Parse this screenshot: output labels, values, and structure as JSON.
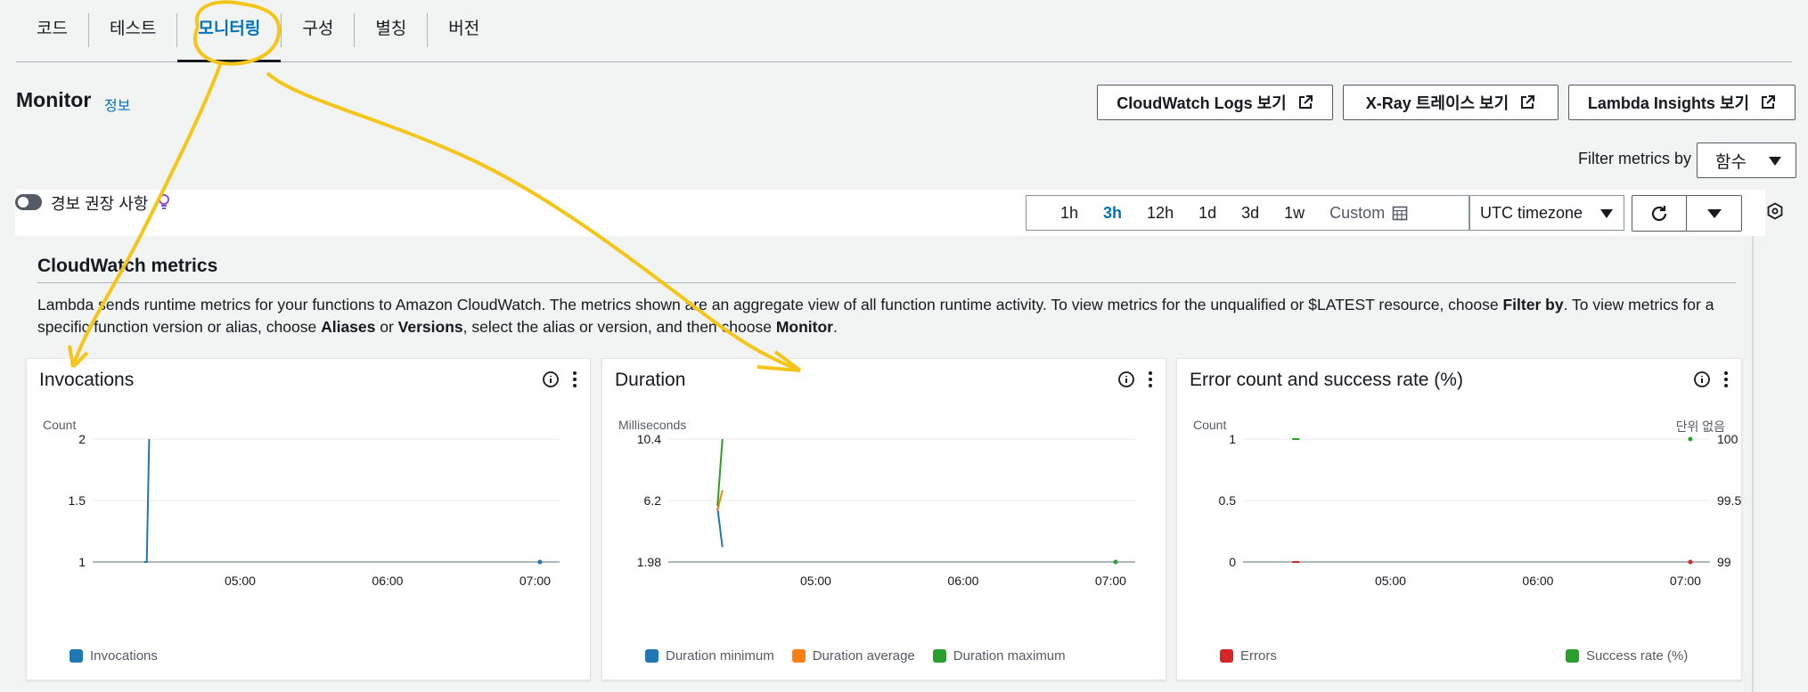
{
  "tabs": [
    {
      "label": "코드",
      "active": false
    },
    {
      "label": "테스트",
      "active": false
    },
    {
      "label": "모니터링",
      "active": true
    },
    {
      "label": "구성",
      "active": false
    },
    {
      "label": "별칭",
      "active": false
    },
    {
      "label": "버전",
      "active": false
    }
  ],
  "header": {
    "title": "Monitor",
    "info": "정보",
    "buttons": {
      "cloudwatch_logs": "CloudWatch Logs 보기",
      "xray": "X-Ray 트레이스 보기",
      "lambda_insights": "Lambda Insights 보기"
    },
    "filter_label": "Filter metrics by",
    "filter_value": "함수"
  },
  "toolbar": {
    "alarm_label": "경보 권장 사항",
    "time_ranges": [
      "1h",
      "3h",
      "12h",
      "1d",
      "3d",
      "1w"
    ],
    "active_range": "3h",
    "custom_label": "Custom",
    "timezone": "UTC timezone"
  },
  "section": {
    "title": "CloudWatch metrics",
    "desc_1": "Lambda sends runtime metrics for your functions to Amazon CloudWatch. The metrics shown are an aggregate view of all function runtime activity. To view metrics for the unqualified or $LATEST resource, choose ",
    "desc_b1": "Filter by",
    "desc_2": ". To view metrics for a specific function version or alias, choose ",
    "desc_b2": "Aliases",
    "desc_3": " or ",
    "desc_b3": "Versions",
    "desc_4": ", select the alias or version, and then choose ",
    "desc_b4": "Monitor",
    "desc_5": "."
  },
  "colors": {
    "blue": "#1f77b4",
    "orange": "#ff7f0e",
    "green": "#2ca02c",
    "red": "#d62728",
    "accent": "#0073bb",
    "annotation": "#f5c518"
  },
  "chart_data": [
    {
      "type": "line",
      "title": "Invocations",
      "ylabel": "Count",
      "ylim": [
        1,
        2
      ],
      "yticks": [
        "2",
        "1.5",
        "1"
      ],
      "x_ticks": [
        "05:00",
        "06:00",
        "07:00"
      ],
      "series": [
        {
          "name": "Invocations",
          "color": "#1f77b4",
          "points": [
            [
              "04:21",
              1
            ],
            [
              "04:22",
              1
            ],
            [
              "04:23",
              2
            ],
            [
              "07:02",
              1
            ]
          ]
        }
      ]
    },
    {
      "type": "line",
      "title": "Duration",
      "ylabel": "Milliseconds",
      "ylim": [
        1.98,
        10.4
      ],
      "yticks": [
        "10.4",
        "6.2",
        "1.98"
      ],
      "x_ticks": [
        "05:00",
        "06:00",
        "07:00"
      ],
      "series": [
        {
          "name": "Duration minimum",
          "color": "#1f77b4",
          "points": [
            [
              "04:20",
              5.7
            ],
            [
              "04:22",
              3.0
            ]
          ]
        },
        {
          "name": "Duration average",
          "color": "#ff7f0e",
          "points": [
            [
              "04:20",
              5.5
            ],
            [
              "04:22",
              6.9
            ]
          ]
        },
        {
          "name": "Duration maximum",
          "color": "#2ca02c",
          "points": [
            [
              "04:20",
              5.8
            ],
            [
              "04:22",
              10.4
            ]
          ]
        }
      ]
    },
    {
      "type": "line",
      "title": "Error count and success rate (%)",
      "ylabel": "Count",
      "y2label": "단위 없음",
      "ylim": [
        0,
        1
      ],
      "y2lim": [
        99,
        100
      ],
      "yticks": [
        "1",
        "0.5",
        "0"
      ],
      "y2ticks": [
        "100",
        "99.5",
        "99"
      ],
      "x_ticks": [
        "05:00",
        "06:00",
        "07:00"
      ],
      "series": [
        {
          "name": "Errors",
          "color": "#d62728",
          "points": [
            [
              "04:20",
              0
            ],
            [
              "04:23",
              0
            ],
            [
              "07:02",
              0
            ]
          ]
        },
        {
          "name": "Success rate (%)",
          "color": "#2ca02c",
          "axis": "right",
          "points": [
            [
              "04:20",
              100
            ],
            [
              "04:23",
              100
            ],
            [
              "07:02",
              100
            ]
          ]
        }
      ]
    }
  ]
}
